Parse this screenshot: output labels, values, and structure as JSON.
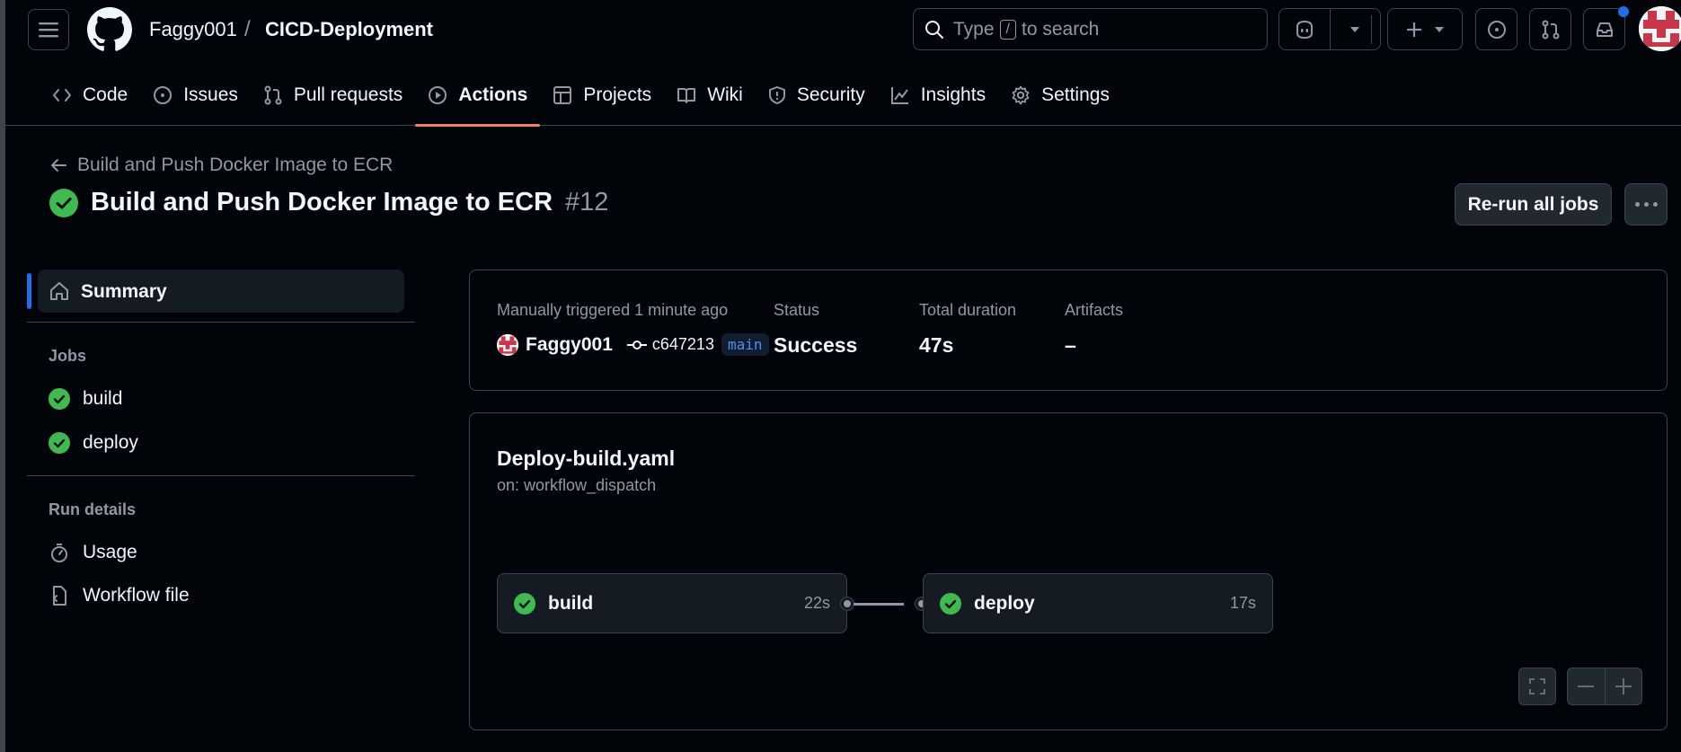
{
  "header": {
    "owner": "Faggy001",
    "separator": "/",
    "repo": "CICD-Deployment",
    "search": {
      "prefix": "Type",
      "key": "/",
      "suffix": "to search"
    }
  },
  "tabs": [
    {
      "label": "Code",
      "icon": "code-icon"
    },
    {
      "label": "Issues",
      "icon": "issue-icon"
    },
    {
      "label": "Pull requests",
      "icon": "pull-request-icon"
    },
    {
      "label": "Actions",
      "icon": "play-icon",
      "active": true
    },
    {
      "label": "Projects",
      "icon": "table-icon"
    },
    {
      "label": "Wiki",
      "icon": "book-icon"
    },
    {
      "label": "Security",
      "icon": "shield-icon"
    },
    {
      "label": "Insights",
      "icon": "graph-icon"
    },
    {
      "label": "Settings",
      "icon": "gear-icon"
    }
  ],
  "run": {
    "back_label": "Build and Push Docker Image to ECR",
    "title": "Build and Push Docker Image to ECR",
    "number": "#12",
    "rerun_label": "Re-run all jobs"
  },
  "sidebar": {
    "summary_label": "Summary",
    "jobs_heading": "Jobs",
    "jobs": [
      {
        "label": "build",
        "status": "success"
      },
      {
        "label": "deploy",
        "status": "success"
      }
    ],
    "details_heading": "Run details",
    "details": [
      {
        "label": "Usage",
        "icon": "stopwatch-icon"
      },
      {
        "label": "Workflow file",
        "icon": "file-code-icon"
      }
    ]
  },
  "summary": {
    "trigger_label": "Manually triggered 1 minute ago",
    "actor": "Faggy001",
    "commit": "c647213",
    "branch": "main",
    "status_label": "Status",
    "status_value": "Success",
    "duration_label": "Total duration",
    "duration_value": "47s",
    "artifacts_label": "Artifacts",
    "artifacts_value": "–"
  },
  "workflow": {
    "file": "Deploy-build.yaml",
    "trigger": "on: workflow_dispatch",
    "jobs": [
      {
        "name": "build",
        "duration": "22s",
        "status": "success"
      },
      {
        "name": "deploy",
        "duration": "17s",
        "status": "success"
      }
    ]
  },
  "colors": {
    "success": "#3fb950",
    "accent": "#1f6feb",
    "tab_underline": "#f78166",
    "background": "#010409"
  }
}
